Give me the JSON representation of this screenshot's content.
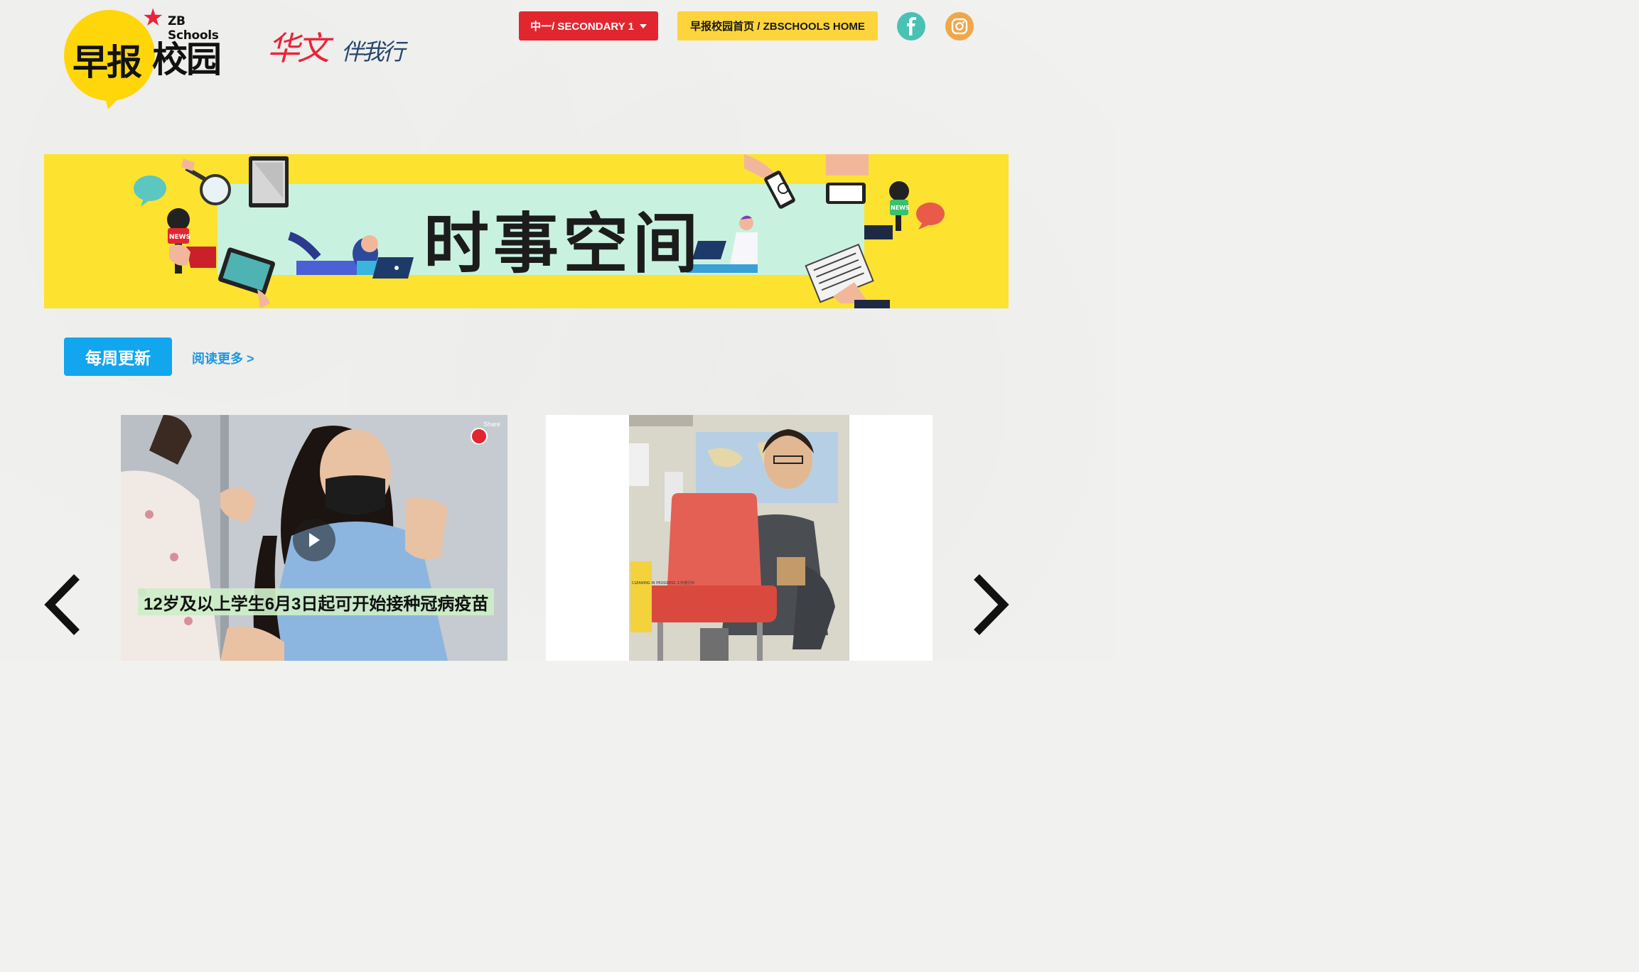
{
  "header": {
    "logo_zb": {
      "en": "ZB Schools",
      "zh_part1": "早报",
      "zh_part2": "校园"
    },
    "logo_huawen": {
      "part1": "华文",
      "part2": "伴我行"
    },
    "level_button": {
      "label": "中一/ SECONDARY 1",
      "color": "#e2262f"
    },
    "home_button": {
      "label": "早报校园首页 / ZBSCHOOLS HOME",
      "color": "#fdd43b"
    },
    "social": [
      {
        "name": "facebook",
        "icon": "facebook-icon"
      },
      {
        "name": "instagram",
        "icon": "instagram-icon"
      }
    ]
  },
  "banner": {
    "title": "时事空间",
    "mic_label": "NEWS",
    "background": "#fde22f",
    "panel_color": "#c8f2df"
  },
  "weekly": {
    "tag_label": "每周更新",
    "read_more": "阅读更多 >"
  },
  "carousel": {
    "cards": [
      {
        "caption": "12岁及以上学生6月3日起可开始接种冠病疫苗",
        "type": "video",
        "share_label": "Share"
      },
      {
        "caption": "",
        "type": "image",
        "sign_text": "CLEANING IN PROGRESS 工作进行中"
      }
    ],
    "prev_icon": "chevron-left-icon",
    "next_icon": "chevron-right-icon"
  }
}
